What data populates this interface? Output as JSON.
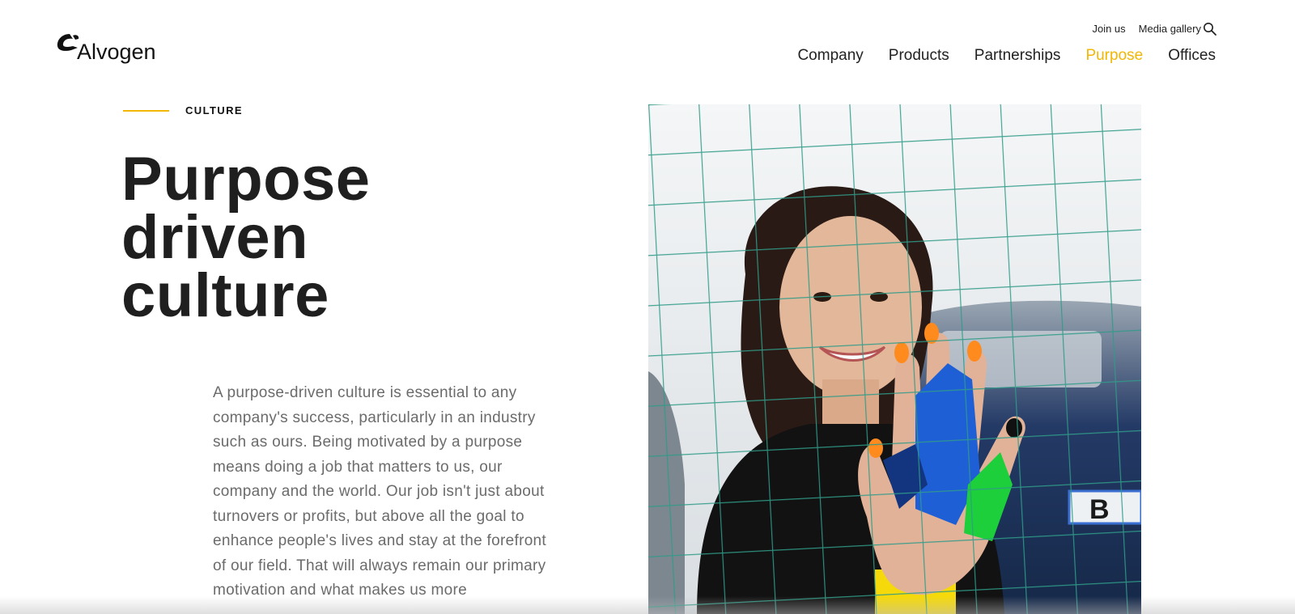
{
  "header": {
    "logo_text": "Alvogen",
    "utility_links": [
      {
        "label": "Join us"
      },
      {
        "label": "Media gallery"
      }
    ],
    "search_icon": "search-icon",
    "nav": [
      {
        "label": "Company",
        "active": false
      },
      {
        "label": "Products",
        "active": false
      },
      {
        "label": "Partnerships",
        "active": false
      },
      {
        "label": "Purpose",
        "active": true
      },
      {
        "label": "Offices",
        "active": false
      }
    ]
  },
  "hero": {
    "eyebrow": "CULTURE",
    "headline_lines": [
      "Purpose",
      "driven",
      "culture"
    ],
    "body": "A purpose-driven culture is essential to any company's success, particularly in an industry such as ours. Being motivated by a purpose means doing a job that matters to us, our company and the world. Our job isn't just about turnovers or profits, but above all the goal to enhance people's lives and stay at the forefront of our field. That will always remain our primary motivation and what makes us more"
  },
  "photo": {
    "plate_text": "B"
  },
  "colors": {
    "accent": "#f2b705",
    "text_dark": "#1f1f1f",
    "text_body": "#6b6b6b"
  }
}
